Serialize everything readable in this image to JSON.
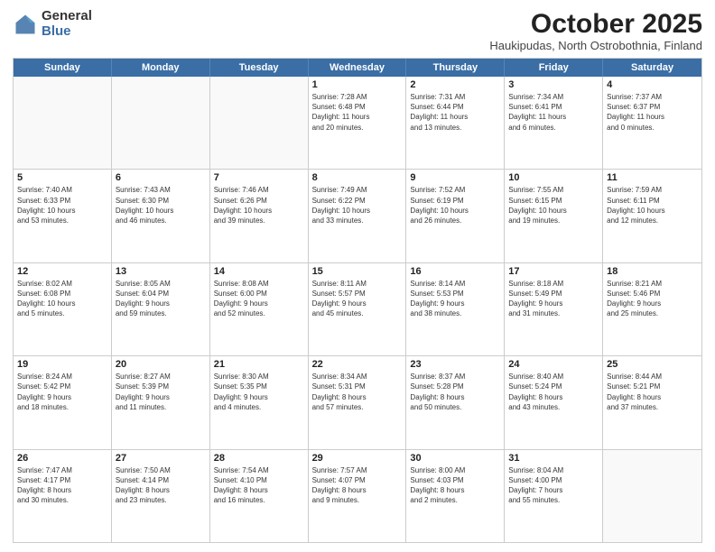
{
  "logo": {
    "general": "General",
    "blue": "Blue"
  },
  "title": "October 2025",
  "location": "Haukipudas, North Ostrobothnia, Finland",
  "dayHeaders": [
    "Sunday",
    "Monday",
    "Tuesday",
    "Wednesday",
    "Thursday",
    "Friday",
    "Saturday"
  ],
  "weeks": [
    [
      {
        "day": "",
        "info": ""
      },
      {
        "day": "",
        "info": ""
      },
      {
        "day": "",
        "info": ""
      },
      {
        "day": "1",
        "info": "Sunrise: 7:28 AM\nSunset: 6:48 PM\nDaylight: 11 hours\nand 20 minutes."
      },
      {
        "day": "2",
        "info": "Sunrise: 7:31 AM\nSunset: 6:44 PM\nDaylight: 11 hours\nand 13 minutes."
      },
      {
        "day": "3",
        "info": "Sunrise: 7:34 AM\nSunset: 6:41 PM\nDaylight: 11 hours\nand 6 minutes."
      },
      {
        "day": "4",
        "info": "Sunrise: 7:37 AM\nSunset: 6:37 PM\nDaylight: 11 hours\nand 0 minutes."
      }
    ],
    [
      {
        "day": "5",
        "info": "Sunrise: 7:40 AM\nSunset: 6:33 PM\nDaylight: 10 hours\nand 53 minutes."
      },
      {
        "day": "6",
        "info": "Sunrise: 7:43 AM\nSunset: 6:30 PM\nDaylight: 10 hours\nand 46 minutes."
      },
      {
        "day": "7",
        "info": "Sunrise: 7:46 AM\nSunset: 6:26 PM\nDaylight: 10 hours\nand 39 minutes."
      },
      {
        "day": "8",
        "info": "Sunrise: 7:49 AM\nSunset: 6:22 PM\nDaylight: 10 hours\nand 33 minutes."
      },
      {
        "day": "9",
        "info": "Sunrise: 7:52 AM\nSunset: 6:19 PM\nDaylight: 10 hours\nand 26 minutes."
      },
      {
        "day": "10",
        "info": "Sunrise: 7:55 AM\nSunset: 6:15 PM\nDaylight: 10 hours\nand 19 minutes."
      },
      {
        "day": "11",
        "info": "Sunrise: 7:59 AM\nSunset: 6:11 PM\nDaylight: 10 hours\nand 12 minutes."
      }
    ],
    [
      {
        "day": "12",
        "info": "Sunrise: 8:02 AM\nSunset: 6:08 PM\nDaylight: 10 hours\nand 5 minutes."
      },
      {
        "day": "13",
        "info": "Sunrise: 8:05 AM\nSunset: 6:04 PM\nDaylight: 9 hours\nand 59 minutes."
      },
      {
        "day": "14",
        "info": "Sunrise: 8:08 AM\nSunset: 6:00 PM\nDaylight: 9 hours\nand 52 minutes."
      },
      {
        "day": "15",
        "info": "Sunrise: 8:11 AM\nSunset: 5:57 PM\nDaylight: 9 hours\nand 45 minutes."
      },
      {
        "day": "16",
        "info": "Sunrise: 8:14 AM\nSunset: 5:53 PM\nDaylight: 9 hours\nand 38 minutes."
      },
      {
        "day": "17",
        "info": "Sunrise: 8:18 AM\nSunset: 5:49 PM\nDaylight: 9 hours\nand 31 minutes."
      },
      {
        "day": "18",
        "info": "Sunrise: 8:21 AM\nSunset: 5:46 PM\nDaylight: 9 hours\nand 25 minutes."
      }
    ],
    [
      {
        "day": "19",
        "info": "Sunrise: 8:24 AM\nSunset: 5:42 PM\nDaylight: 9 hours\nand 18 minutes."
      },
      {
        "day": "20",
        "info": "Sunrise: 8:27 AM\nSunset: 5:39 PM\nDaylight: 9 hours\nand 11 minutes."
      },
      {
        "day": "21",
        "info": "Sunrise: 8:30 AM\nSunset: 5:35 PM\nDaylight: 9 hours\nand 4 minutes."
      },
      {
        "day": "22",
        "info": "Sunrise: 8:34 AM\nSunset: 5:31 PM\nDaylight: 8 hours\nand 57 minutes."
      },
      {
        "day": "23",
        "info": "Sunrise: 8:37 AM\nSunset: 5:28 PM\nDaylight: 8 hours\nand 50 minutes."
      },
      {
        "day": "24",
        "info": "Sunrise: 8:40 AM\nSunset: 5:24 PM\nDaylight: 8 hours\nand 43 minutes."
      },
      {
        "day": "25",
        "info": "Sunrise: 8:44 AM\nSunset: 5:21 PM\nDaylight: 8 hours\nand 37 minutes."
      }
    ],
    [
      {
        "day": "26",
        "info": "Sunrise: 7:47 AM\nSunset: 4:17 PM\nDaylight: 8 hours\nand 30 minutes."
      },
      {
        "day": "27",
        "info": "Sunrise: 7:50 AM\nSunset: 4:14 PM\nDaylight: 8 hours\nand 23 minutes."
      },
      {
        "day": "28",
        "info": "Sunrise: 7:54 AM\nSunset: 4:10 PM\nDaylight: 8 hours\nand 16 minutes."
      },
      {
        "day": "29",
        "info": "Sunrise: 7:57 AM\nSunset: 4:07 PM\nDaylight: 8 hours\nand 9 minutes."
      },
      {
        "day": "30",
        "info": "Sunrise: 8:00 AM\nSunset: 4:03 PM\nDaylight: 8 hours\nand 2 minutes."
      },
      {
        "day": "31",
        "info": "Sunrise: 8:04 AM\nSunset: 4:00 PM\nDaylight: 7 hours\nand 55 minutes."
      },
      {
        "day": "",
        "info": ""
      }
    ]
  ]
}
